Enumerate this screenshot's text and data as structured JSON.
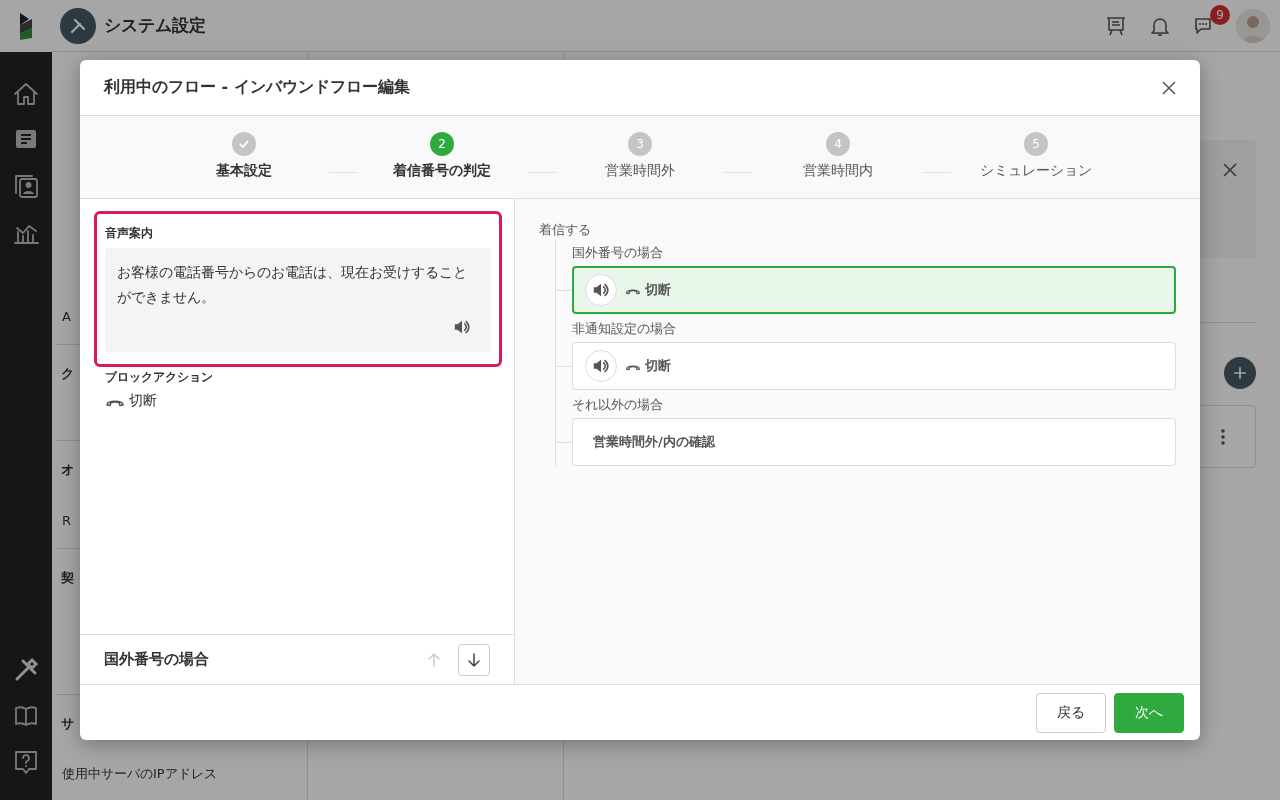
{
  "header": {
    "title": "システム設定",
    "notification_count": "9"
  },
  "settings_nav": {
    "items": [
      {
        "kind": "item",
        "label": "A"
      },
      {
        "kind": "section",
        "label": "ク"
      },
      {
        "kind": "section",
        "label": "オ"
      },
      {
        "kind": "item",
        "label": "R"
      },
      {
        "kind": "section",
        "label": "契"
      },
      {
        "kind": "section",
        "label": "サ"
      },
      {
        "kind": "item",
        "label": "使用中サーバのIPアドレス"
      }
    ]
  },
  "dialog": {
    "title": "利用中のフロー - インバウンドフロー編集",
    "steps": [
      {
        "completed": true,
        "selected": false,
        "label": "基本設定"
      },
      {
        "completed": false,
        "selected": true,
        "number": "2",
        "label": "着信番号の判定"
      },
      {
        "completed": false,
        "selected": false,
        "number": "3",
        "label": "営業時間外"
      },
      {
        "completed": false,
        "selected": false,
        "number": "4",
        "label": "営業時間内"
      },
      {
        "completed": false,
        "selected": false,
        "number": "5",
        "label": "シミュレーション"
      }
    ],
    "detail": {
      "highlighted": true,
      "voice_label": "音声案内",
      "voice_text": "お客様の電話番号からのお電話は、現在お受けすることができません。",
      "action_label": "ブロックアクション",
      "action": "切断"
    },
    "detail_footer": {
      "label": "国外番号の場合",
      "up_disabled": true,
      "down_disabled": false
    },
    "flow": {
      "root": "着信する",
      "branches": [
        {
          "condition": "国外番号の場合",
          "kind": "action",
          "action": "切断",
          "selected": true
        },
        {
          "condition": "非通知設定の場合",
          "kind": "action",
          "action": "切断",
          "selected": false
        },
        {
          "condition": "それ以外の場合",
          "kind": "step",
          "label": "営業時間外/内の確認",
          "selected": false
        }
      ]
    },
    "buttons": [
      {
        "kind": "secondary",
        "label": "戻る"
      },
      {
        "kind": "primary",
        "label": "次へ"
      }
    ]
  }
}
